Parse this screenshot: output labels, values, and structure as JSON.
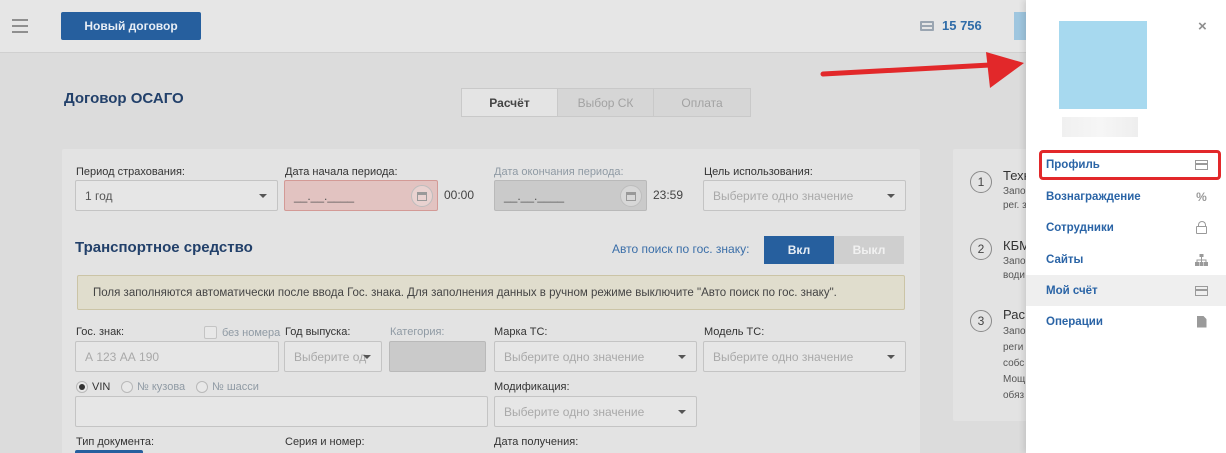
{
  "topbar": {
    "new_contract_label": "Новый договор",
    "balance": "15 756"
  },
  "page": {
    "title": "Договор ОСАГО",
    "steps": [
      "Расчёт",
      "Выбор СК",
      "Оплата"
    ]
  },
  "form": {
    "period_label": "Период страхования:",
    "period_value": "1 год",
    "start_label": "Дата начала периода:",
    "start_value": "__.__.____",
    "start_time": "00:00",
    "end_label": "Дата окончания периода:",
    "end_value": "__.__.____",
    "end_time": "23:59",
    "purpose_label": "Цель использования:",
    "purpose_placeholder": "Выберите одно значение",
    "vehicle_title": "Транспортное средство",
    "auto_search_label": "Авто поиск по гос. знаку:",
    "toggle_on": "Вкл",
    "toggle_off": "Выкл",
    "notice": "Поля заполняются автоматически после ввода Гос. знака. Для заполнения данных в ручном режиме выключите \"Авто поиск по гос. знаку\".",
    "plate_label": "Гос. знак:",
    "no_plate_label": "без номера",
    "plate_placeholder": "А 123 АА 190",
    "year_label": "Год выпуска:",
    "year_placeholder": "Выберите од",
    "category_label": "Категория:",
    "brand_label": "Марка ТС:",
    "brand_placeholder": "Выберите одно значение",
    "model_label": "Модель ТС:",
    "model_placeholder": "Выберите одно значение",
    "radio_vin": "VIN",
    "radio_body": "№ кузова",
    "radio_chassis": "№ шасси",
    "modification_label": "Модификация:",
    "modification_placeholder": "Выберите одно значение",
    "doc_type_label": "Тип документа:",
    "series_label": "Серия и номер:",
    "received_label": "Дата получения:"
  },
  "right_card": {
    "steps": [
      {
        "num": "1",
        "title": "Техн",
        "sub": [
          "Запо",
          "рег. з"
        ]
      },
      {
        "num": "2",
        "title": "КБМ",
        "sub": [
          "Запо",
          "води"
        ]
      },
      {
        "num": "3",
        "title": "Рас",
        "sub": [
          "Запо",
          "реги",
          "собс",
          "Мощ",
          "обяз"
        ]
      }
    ]
  },
  "panel": {
    "close_glyph": "×",
    "menu": [
      {
        "label": "Профиль",
        "icon": "card-icon"
      },
      {
        "label": "Вознаграждение",
        "icon": "percent-icon"
      },
      {
        "label": "Сотрудники",
        "icon": "lock-icon"
      },
      {
        "label": "Сайты",
        "icon": "sitemap-icon"
      },
      {
        "label": "Мой счёт",
        "icon": "card-icon"
      },
      {
        "label": "Операции",
        "icon": "document-icon"
      }
    ]
  },
  "colors": {
    "brand": "#265f9e",
    "link": "#2a64a6",
    "highlight": "#e2282a",
    "avatar": "#a7d9ef"
  }
}
